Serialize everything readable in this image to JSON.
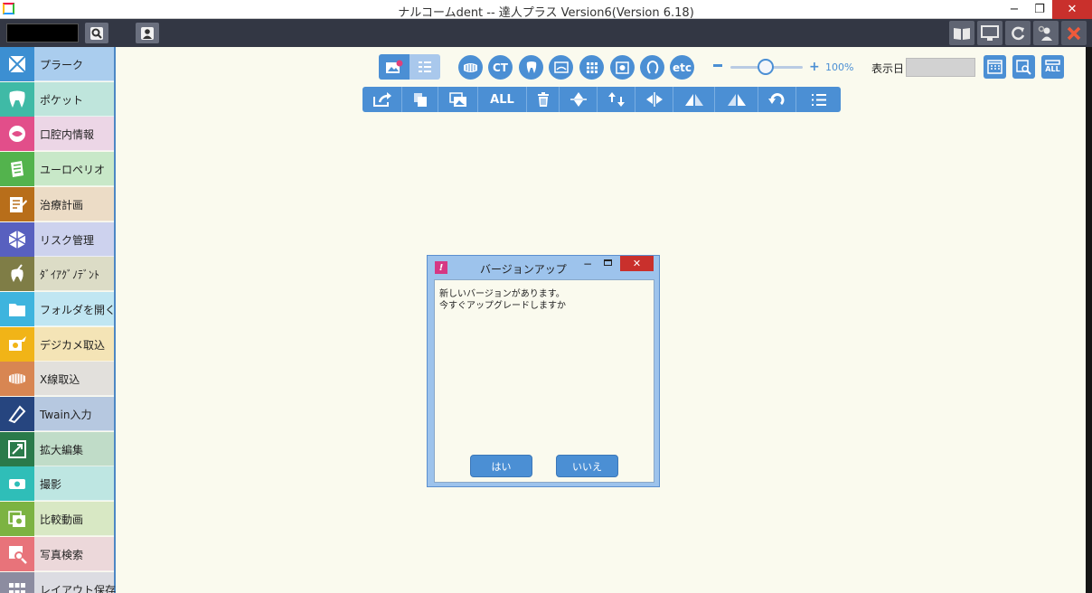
{
  "window": {
    "title": "ナルコームdent -- 達人プラス Version6(Version 6.18)",
    "minimize": "−",
    "restore": "❐",
    "close": "✕"
  },
  "toolbar": {
    "search_value": ""
  },
  "sidebar": {
    "items": [
      {
        "label": "プラーク",
        "icon": "plaque-icon",
        "icon_bg": "#3c8fd2",
        "bg": "#aacdee"
      },
      {
        "label": "ポケット",
        "icon": "tooth-icon",
        "icon_bg": "#3fbaa6",
        "bg": "#bfe5dc"
      },
      {
        "label": "口腔内情報",
        "icon": "mouth-icon",
        "icon_bg": "#e24e8a",
        "bg": "#ecd6e6"
      },
      {
        "label": "ユーロペリオ",
        "icon": "checklist-icon",
        "icon_bg": "#53b34d",
        "bg": "#c8e8c8"
      },
      {
        "label": "治療計画",
        "icon": "plan-icon",
        "icon_bg": "#b86e1a",
        "bg": "#ecdcc6"
      },
      {
        "label": "リスク管理",
        "icon": "risk-icon",
        "icon_bg": "#5860bf",
        "bg": "#cdd2ee"
      },
      {
        "label": "ﾀﾞｲｱｸﾞﾉﾃﾞﾝﾄ",
        "icon": "diagnodent-icon",
        "icon_bg": "#7f7d46",
        "bg": "#dcdcc6"
      },
      {
        "label": "フォルダを開く",
        "icon": "folder-icon",
        "icon_bg": "#3eb4de",
        "bg": "#c0e6f2"
      },
      {
        "label": "デジカメ取込",
        "icon": "camera-import-icon",
        "icon_bg": "#f1b417",
        "bg": "#f4e4b6"
      },
      {
        "label": "X線取込",
        "icon": "xray-icon",
        "icon_bg": "#d88652",
        "bg": "#e2e0dc"
      },
      {
        "label": "Twain入力",
        "icon": "scanner-icon",
        "icon_bg": "#26457f",
        "bg": "#b6c8e0"
      },
      {
        "label": "拡大編集",
        "icon": "zoom-edit-icon",
        "icon_bg": "#2a7a4a",
        "bg": "#c0dcc8"
      },
      {
        "label": "撮影",
        "icon": "camera-icon",
        "icon_bg": "#2fbeb8",
        "bg": "#bee6e2"
      },
      {
        "label": "比較動画",
        "icon": "compare-video-icon",
        "icon_bg": "#7cb342",
        "bg": "#d8e8c4"
      },
      {
        "label": "写真検索",
        "icon": "photo-search-icon",
        "icon_bg": "#e8737a",
        "bg": "#ecd8da"
      },
      {
        "label": "レイアウト保存",
        "icon": "layout-icon",
        "icon_bg": "#8c8ca0",
        "bg": "#dcdce2"
      }
    ]
  },
  "categories": {
    "ct_label": "CT",
    "etc_label": "etc"
  },
  "zoom": {
    "minus": "−",
    "plus": "+",
    "level": "100%"
  },
  "date": {
    "label": "表示日",
    "value": ""
  },
  "edit_toolbar": {
    "all_label": "ALL"
  },
  "calendar_all_label": "ALL",
  "dialog": {
    "title": "バージョンアップ",
    "icon_letter": "!",
    "message_line1": "新しいバージョンがあります。",
    "message_line2": "今すぐアップグレードしますか",
    "yes": "はい",
    "no": "いいえ",
    "minimize": "−",
    "close": "✕"
  },
  "colors": {
    "accent": "#4b8fd4",
    "toolbar_bg": "#333744",
    "canvas_bg": "#fafaee",
    "close_red": "#c9302c"
  }
}
